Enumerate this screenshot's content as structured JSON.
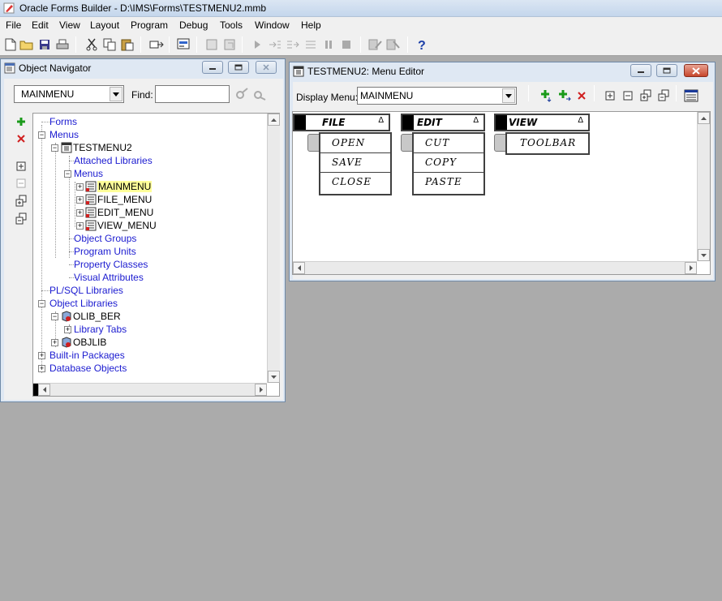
{
  "app": {
    "title": "Oracle Forms Builder - D:\\IMS\\Forms\\TESTMENU2.mmb"
  },
  "menubar": [
    "File",
    "Edit",
    "View",
    "Layout",
    "Program",
    "Debug",
    "Tools",
    "Window",
    "Help"
  ],
  "toolbar": {
    "icons": [
      "new-icon",
      "open-icon",
      "save-icon",
      "print-icon",
      "cut-icon",
      "copy-icon",
      "paste-icon",
      "compile-icon",
      "run-form-icon",
      "run-debug-icon",
      "run-web-icon",
      "step-into-icon",
      "step-over-icon",
      "step-out-icon",
      "pause-icon",
      "stop-icon",
      "connect-icon",
      "disconnect-icon",
      "help-icon"
    ]
  },
  "navigator": {
    "title": "Object Navigator",
    "combo_value": "MAINMENU",
    "find_label": "Find:",
    "find_value": "",
    "tree": {
      "forms": "Forms",
      "menus": "Menus",
      "testmenu2": "TESTMENU2",
      "attached_libraries": "Attached Libraries",
      "menus_sub": "Menus",
      "mainmenu": "MAINMENU",
      "file_menu": "FILE_MENU",
      "edit_menu": "EDIT_MENU",
      "view_menu": "VIEW_MENU",
      "object_groups": "Object Groups",
      "program_units": "Program Units",
      "property_classes": "Property Classes",
      "visual_attributes": "Visual Attributes",
      "plsql_libraries": "PL/SQL Libraries",
      "object_libraries": "Object Libraries",
      "olib_ber": "OLIB_BER",
      "library_tabs": "Library Tabs",
      "objlib": "OBJLIB",
      "builtin_packages": "Built-in Packages",
      "database_objects": "Database Objects"
    }
  },
  "menu_editor": {
    "title": "TESTMENU2: Menu Editor",
    "display_menu_label": "Display Menu:",
    "display_menu_value": "MAINMENU",
    "menus": [
      {
        "header": "FILE",
        "items": [
          "OPEN",
          "SAVE",
          "CLOSE"
        ]
      },
      {
        "header": "EDIT",
        "items": [
          "CUT",
          "COPY",
          "PASTE"
        ]
      },
      {
        "header": "VIEW",
        "items": [
          "TOOLBAR"
        ]
      }
    ]
  },
  "colors": {
    "desktop": "#ababab",
    "tree_link": "#1b1bd0",
    "highlight": "#ffff99",
    "close_button": "#c7462c"
  }
}
